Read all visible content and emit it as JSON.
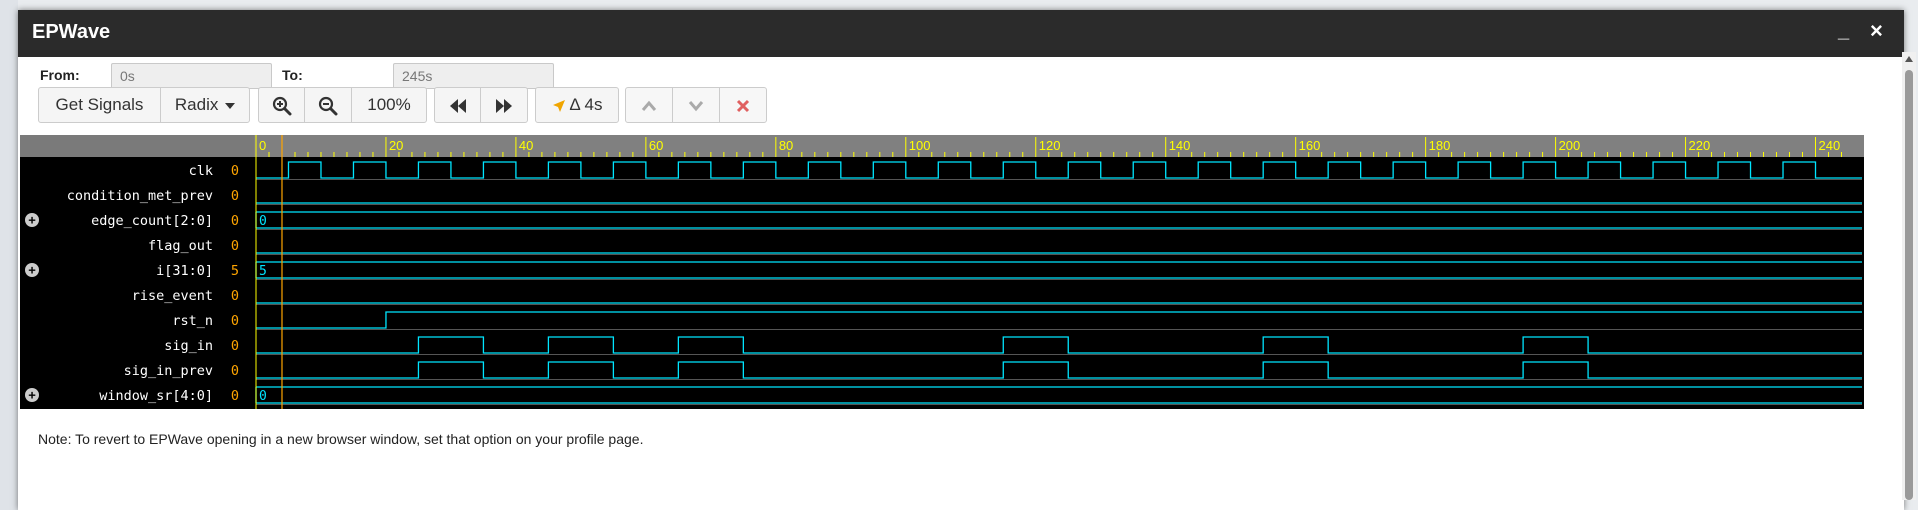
{
  "window": {
    "title": "EPWave",
    "minimize_label": "_",
    "close_label": "×"
  },
  "range": {
    "from_label": "From:",
    "from_value": "0s",
    "to_label": "To:",
    "to_value": "245s"
  },
  "toolbar": {
    "get_signals_label": "Get Signals",
    "radix_label": "Radix",
    "zoom_level": "100%",
    "delta_label": "Δ 4s"
  },
  "colors": {
    "wave": "#00e5ff",
    "tick": "#ffff00",
    "value": "#ffa500",
    "cursor": "#ffa500",
    "ruler_bg": "#808080"
  },
  "waveform": {
    "time_max": 245,
    "ticks": [
      "0",
      "20",
      "40",
      "60",
      "80",
      "100",
      "120",
      "140",
      "160",
      "180",
      "200",
      "220",
      "240"
    ],
    "cursor_time": 4,
    "signals": [
      {
        "name": "clk",
        "value": "0",
        "kind": "clock",
        "period": 10,
        "first_rise": 5
      },
      {
        "name": "condition_met_prev",
        "value": "0",
        "kind": "bit",
        "transitions": []
      },
      {
        "name": "edge_count[2:0]",
        "value": "0",
        "kind": "bus",
        "expandable": true,
        "bus_value": "0"
      },
      {
        "name": "flag_out",
        "value": "0",
        "kind": "bit",
        "transitions": []
      },
      {
        "name": "i[31:0]",
        "value": "5",
        "kind": "bus",
        "expandable": true,
        "bus_value": "5"
      },
      {
        "name": "rise_event",
        "value": "0",
        "kind": "bit",
        "transitions": []
      },
      {
        "name": "rst_n",
        "value": "0",
        "kind": "bit",
        "transitions": [
          20
        ]
      },
      {
        "name": "sig_in",
        "value": "0",
        "kind": "bit",
        "transitions": [
          25,
          35,
          45,
          55,
          65,
          75,
          115,
          125,
          155,
          165,
          195,
          205
        ]
      },
      {
        "name": "sig_in_prev",
        "value": "0",
        "kind": "bit",
        "transitions": [
          25,
          35,
          45,
          55,
          65,
          75,
          115,
          125,
          155,
          165,
          195,
          205
        ]
      },
      {
        "name": "window_sr[4:0]",
        "value": "0",
        "kind": "bus",
        "expandable": true,
        "bus_value": "0"
      }
    ]
  },
  "note": "Note: To revert to EPWave opening in a new browser window, set that option on your profile page."
}
